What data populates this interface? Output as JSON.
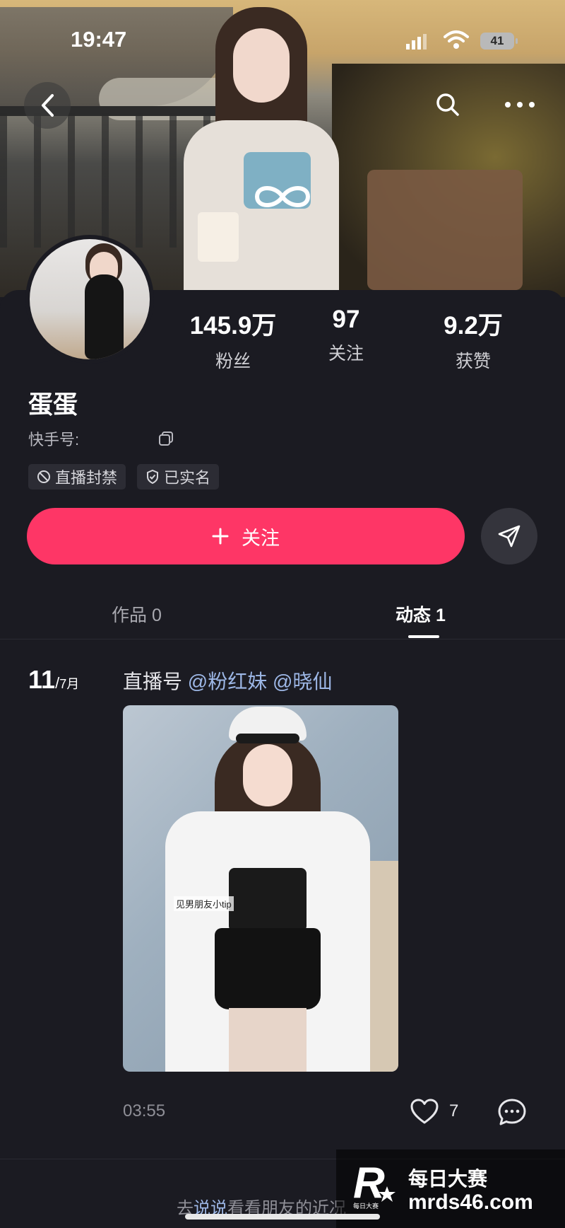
{
  "status_bar": {
    "time": "19:47",
    "battery": "41"
  },
  "profile": {
    "name": "蛋蛋",
    "kwai_id_label": "快手号:",
    "stats": [
      {
        "value": "145.9万",
        "label": "粉丝"
      },
      {
        "value": "97",
        "label": "关注"
      },
      {
        "value": "9.2万",
        "label": "获赞"
      }
    ],
    "tags": [
      {
        "label": "直播封禁",
        "icon": "ban-icon"
      },
      {
        "label": "已实名",
        "icon": "shield-check-icon"
      }
    ]
  },
  "actions": {
    "follow_label": "关注",
    "follow_color": "#fe3666"
  },
  "tabs": [
    {
      "label": "作品 0",
      "active": false
    },
    {
      "label": "动态 1",
      "active": true
    }
  ],
  "post": {
    "day": "11",
    "month": "7月",
    "text_prefix": "直播号",
    "mentions": [
      "@粉红妹",
      "@晓仙"
    ],
    "image_caption": "见男朋友小tip",
    "time": "03:55",
    "likes": "7"
  },
  "footer": {
    "prefix": "去",
    "link": "说说",
    "suffix": "看看朋友的近况"
  },
  "watermark": {
    "title": "每日大赛",
    "url": "mrds46.com",
    "logo_text": "R",
    "logo_sub": "每日大赛"
  }
}
